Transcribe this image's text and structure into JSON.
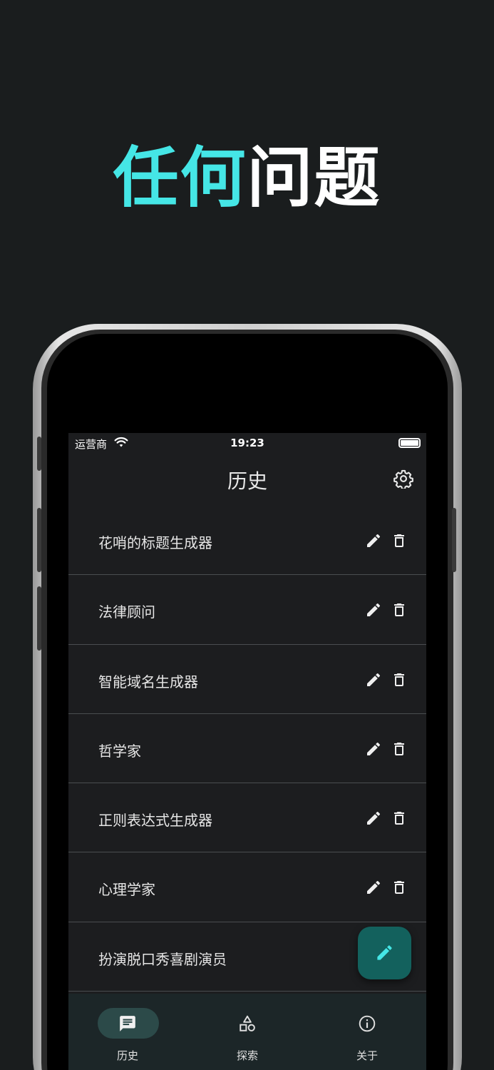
{
  "headline": {
    "accent": "任何",
    "rest": "问题"
  },
  "status_bar": {
    "carrier": "运营商",
    "time": "19:23"
  },
  "header": {
    "title": "历史"
  },
  "history": [
    {
      "title": "花哨的标题生成器"
    },
    {
      "title": "法律顾问"
    },
    {
      "title": "智能域名生成器"
    },
    {
      "title": "哲学家"
    },
    {
      "title": "正则表达式生成器"
    },
    {
      "title": "心理学家"
    },
    {
      "title": "扮演脱口秀喜剧演员"
    }
  ],
  "nav": [
    {
      "label": "历史",
      "icon": "chat-icon",
      "active": true
    },
    {
      "label": "探索",
      "icon": "shapes-icon",
      "active": false
    },
    {
      "label": "关于",
      "icon": "info-icon",
      "active": false
    }
  ],
  "colors": {
    "accent": "#45e6e6",
    "fab": "#13615d",
    "background": "#1a1d1e"
  }
}
